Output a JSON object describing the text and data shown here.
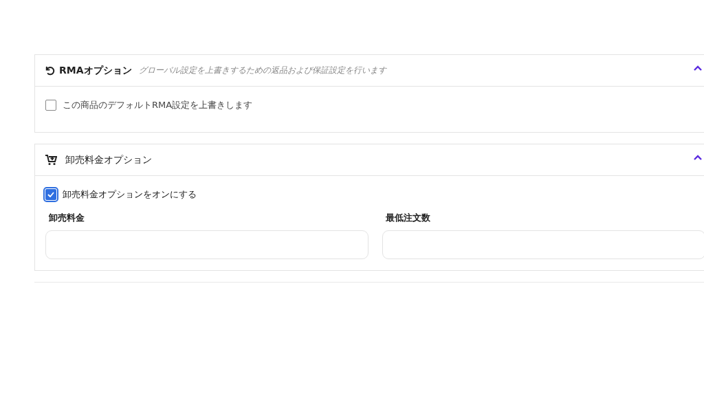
{
  "sections": [
    {
      "kind": "rma",
      "title": "RMAオプション",
      "subtitle": "グローバル設定を上書きするための返品および保証設定を行います",
      "expanded": true,
      "checkbox": {
        "label": "この商品のデフォルトRMA設定を上書きします",
        "checked": false
      }
    },
    {
      "kind": "wholesale",
      "title": "卸売料金オプション",
      "expanded": true,
      "checkbox": {
        "label": "卸売料金オプションをオンにする",
        "checked": true
      },
      "fields": [
        {
          "label": "卸売料金"
        },
        {
          "label": "最低注文数"
        }
      ]
    }
  ]
}
